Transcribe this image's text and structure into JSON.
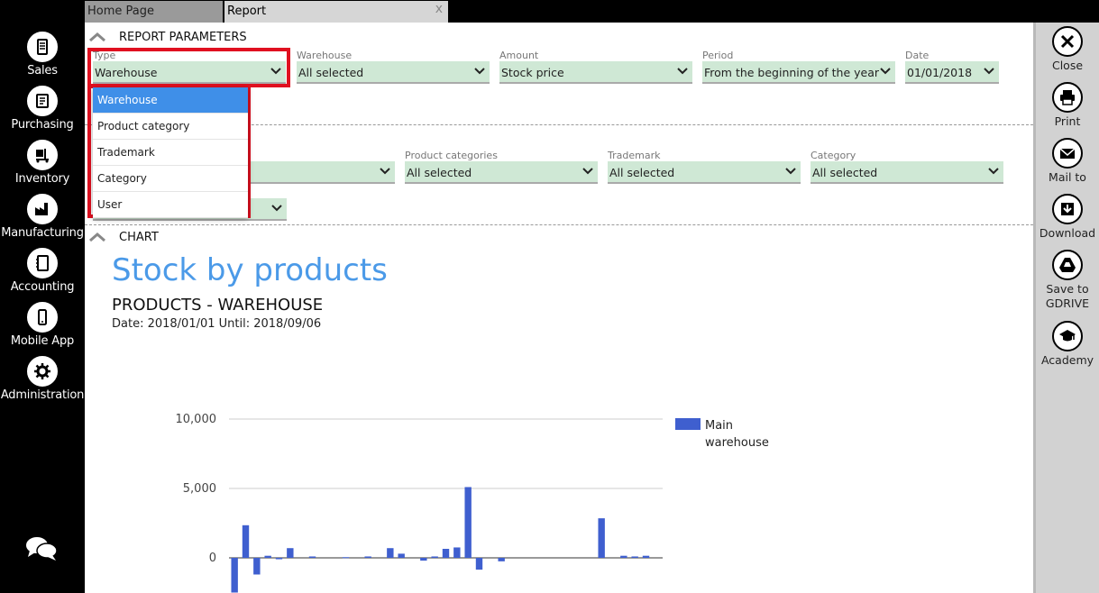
{
  "nav": {
    "items": [
      {
        "label": "Sales",
        "icon": "sales-icon"
      },
      {
        "label": "Purchasing",
        "icon": "purchasing-icon"
      },
      {
        "label": "Inventory",
        "icon": "inventory-icon"
      },
      {
        "label": "Manufacturing",
        "icon": "manufacturing-icon"
      },
      {
        "label": "Accounting",
        "icon": "accounting-icon"
      },
      {
        "label": "Mobile App",
        "icon": "mobile-icon"
      },
      {
        "label": "Administration",
        "icon": "gear-icon"
      }
    ]
  },
  "tabs": [
    {
      "label": "Home Page"
    },
    {
      "label": "Report",
      "close": "x"
    }
  ],
  "toolbar": {
    "items": [
      {
        "label": "Close",
        "icon": "close-icon"
      },
      {
        "label": "Print",
        "icon": "print-icon"
      },
      {
        "label": "Mail to",
        "icon": "mail-icon"
      },
      {
        "label": "Download",
        "icon": "download-icon"
      },
      {
        "label": "Save to GDRIVE",
        "icon": "gdrive-icon"
      },
      {
        "label": "Academy",
        "icon": "academy-icon"
      }
    ]
  },
  "params": {
    "title": "REPORT PARAMETERS",
    "type": {
      "label": "Type",
      "value": "Warehouse"
    },
    "warehouse": {
      "label": "Warehouse",
      "value": "All selected"
    },
    "amount": {
      "label": "Amount",
      "value": "Stock price"
    },
    "period": {
      "label": "Period",
      "value": "From the beginning of the year"
    },
    "date": {
      "label": "Date",
      "value": "01/01/2018"
    },
    "product_categories": {
      "label": "Product categories",
      "value": "All selected"
    },
    "trademark": {
      "label": "Trademark",
      "value": "All selected"
    },
    "category": {
      "label": "Category",
      "value": "All selected"
    },
    "row2_first": {
      "value": ""
    },
    "row3_first": {
      "value": ""
    }
  },
  "dropdown": {
    "options": [
      "Warehouse",
      "Product category",
      "Trademark",
      "Category",
      "User"
    ],
    "selected": "Warehouse"
  },
  "chart_section": {
    "title": "CHART"
  },
  "chart_data": {
    "type": "bar",
    "title": "Stock by products",
    "subtitle": "PRODUCTS - WAREHOUSE",
    "date_range": "Date: 2018/01/01 Until: 2018/09/06",
    "y_ticks": [
      "10,000",
      "5,000",
      "0"
    ],
    "ylim": [
      -2500,
      10000
    ],
    "series": [
      {
        "name": "Main warehouse",
        "color": "#3f5fcf",
        "values": [
          -2500,
          2350,
          -1200,
          150,
          -100,
          700,
          0,
          100,
          0,
          0,
          50,
          0,
          100,
          0,
          700,
          300,
          0,
          -200,
          100,
          650,
          750,
          5100,
          -850,
          0,
          -250,
          0,
          0,
          0,
          0,
          0,
          0,
          0,
          0,
          2850,
          0,
          150,
          100,
          150,
          0
        ]
      }
    ],
    "legend_position": "top-right",
    "grid": true
  }
}
